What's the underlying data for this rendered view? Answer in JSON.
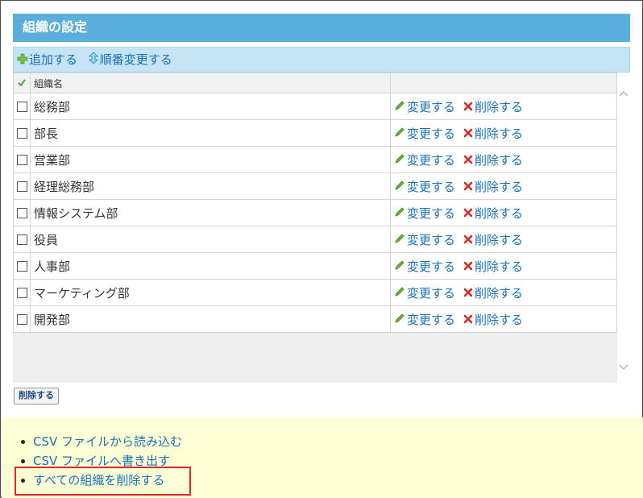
{
  "title": "組織の設定",
  "toolbar": {
    "add_label": "追加する",
    "reorder_label": "順番変更する"
  },
  "table": {
    "column_name": "組織名",
    "edit_label": "変更する",
    "delete_label": "削除する",
    "rows": [
      "総務部",
      "部長",
      "営業部",
      "経理総務部",
      "情報システム部",
      "役員",
      "人事部",
      "マーケティング部",
      "開発部"
    ]
  },
  "delete_button": "削除する",
  "footer": {
    "links": [
      "CSV ファイルから読み込む",
      "CSV ファイルへ書き出す",
      "すべての組織を削除する"
    ]
  },
  "colors": {
    "title_bar": "#5aaedb",
    "toolbar": "#c5e3f5",
    "link": "#1a6fb5",
    "footer": "#ffffd6",
    "highlight": "#e0272e"
  }
}
